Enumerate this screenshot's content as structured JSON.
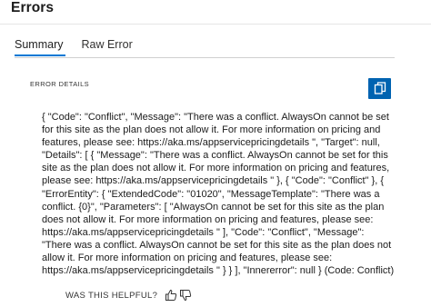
{
  "header": {
    "title": "Errors"
  },
  "tabs": [
    {
      "label": "Summary",
      "active": true
    },
    {
      "label": "Raw Error",
      "active": false
    }
  ],
  "section": {
    "label": "ERROR DETAILS"
  },
  "copy_button": {
    "icon": "copy-icon",
    "color": "#0063b1"
  },
  "error_details": "{ \"Code\": \"Conflict\", \"Message\": \"There was a conflict. AlwaysOn cannot be set for this site as the plan does not allow it. For more information on pricing and features, please see: https://aka.ms/appservicepricingdetails \", \"Target\": null, \"Details\": [ { \"Message\": \"There was a conflict. AlwaysOn cannot be set for this site as the plan does not allow it. For more information on pricing and features, please see: https://aka.ms/appservicepricingdetails \" }, { \"Code\": \"Conflict\" }, { \"ErrorEntity\": { \"ExtendedCode\": \"01020\", \"MessageTemplate\": \"There was a conflict. {0}\", \"Parameters\": [ \"AlwaysOn cannot be set for this site as the plan does not allow it. For more information on pricing and features, please see: https://aka.ms/appservicepricingdetails \" ], \"Code\": \"Conflict\", \"Message\": \"There was a conflict. AlwaysOn cannot be set for this site as the plan does not allow it. For more information on pricing and features, please see: https://aka.ms/appservicepricingdetails \" } } ], \"Innererror\": null } (Code: Conflict)",
  "feedback": {
    "label": "WAS THIS HELPFUL?",
    "thumbs_up_icon": "thumbs-up-icon",
    "thumbs_down_icon": "thumbs-down-icon"
  },
  "colors": {
    "accent": "#0078d4",
    "copy_button": "#0063b1"
  }
}
